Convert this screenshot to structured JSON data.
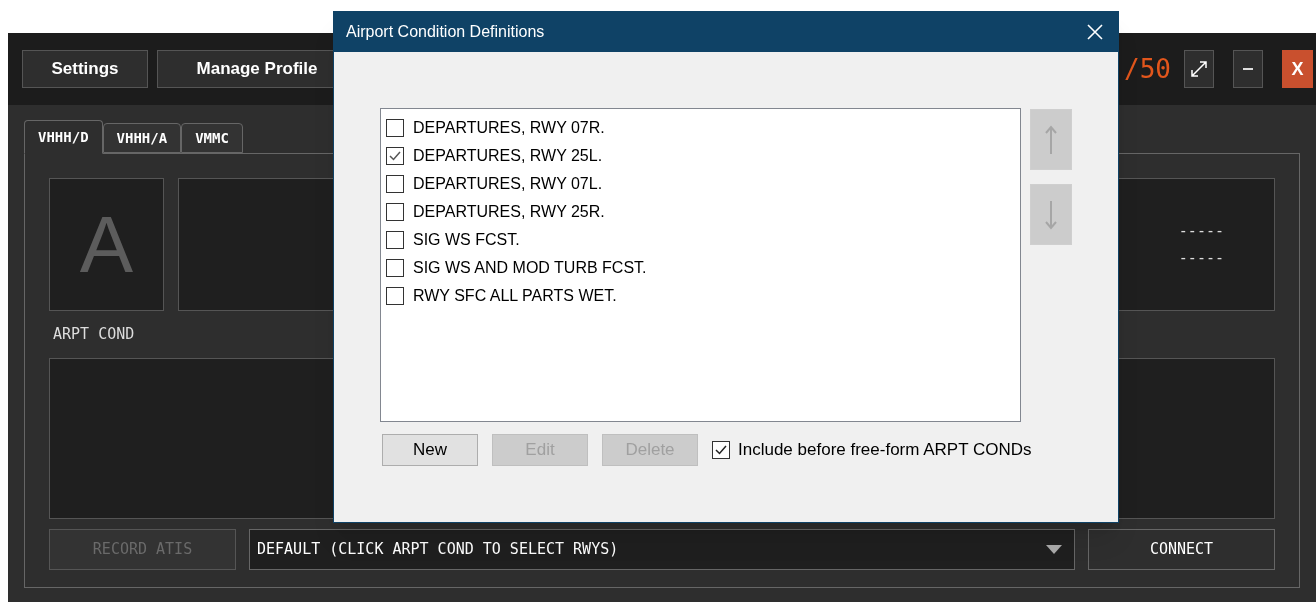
{
  "app": {
    "toolbar_buttons": [
      {
        "label": "Settings"
      },
      {
        "label": "Manage Profile"
      }
    ],
    "counter": "/50",
    "close_label": "X",
    "tabs": [
      {
        "label": "VHHH/D",
        "selected": true
      },
      {
        "label": "VHHH/A",
        "selected": false
      },
      {
        "label": "VMMC",
        "selected": false
      }
    ],
    "indicator_letter": "A",
    "info_lines": [
      "-----",
      "-----"
    ],
    "arpt_cond_label": "ARPT COND",
    "record_button": {
      "label": "RECORD ATIS",
      "disabled": true
    },
    "runway_dropdown": {
      "value": "DEFAULT (CLICK ARPT COND TO SELECT RWYS)"
    },
    "connect_button": {
      "label": "CONNECT",
      "disabled": false
    }
  },
  "dialog": {
    "title": "Airport Condition Definitions",
    "conditions": [
      {
        "label": "DEPARTURES, RWY 07R.",
        "checked": false
      },
      {
        "label": "DEPARTURES, RWY 25L.",
        "checked": true
      },
      {
        "label": "DEPARTURES, RWY 07L.",
        "checked": false
      },
      {
        "label": "DEPARTURES, RWY 25R.",
        "checked": false
      },
      {
        "label": "SIG WS FCST.",
        "checked": false
      },
      {
        "label": "SIG WS AND MOD TURB FCST.",
        "checked": false
      },
      {
        "label": "RWY SFC ALL PARTS WET.",
        "checked": false
      }
    ],
    "move_up_disabled": true,
    "move_down_disabled": true,
    "buttons": [
      {
        "label": "New",
        "disabled": false
      },
      {
        "label": "Edit",
        "disabled": true
      },
      {
        "label": "Delete",
        "disabled": true
      }
    ],
    "include_checkbox": {
      "label": "Include before free-form ARPT CONDs",
      "checked": true
    }
  }
}
